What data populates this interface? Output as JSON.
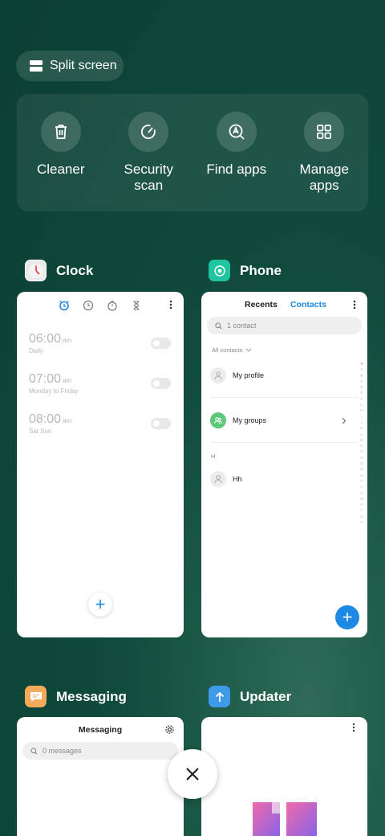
{
  "split_screen": {
    "label": "Split screen",
    "icon": "split-screen-icon"
  },
  "tools": [
    {
      "label": "Cleaner",
      "icon": "trash-icon"
    },
    {
      "label": "Security\nscan",
      "icon": "security-scan-icon"
    },
    {
      "label": "Find apps",
      "icon": "find-apps-icon"
    },
    {
      "label": "Manage\napps",
      "icon": "grid-icon"
    }
  ],
  "apps": {
    "clock": {
      "name": "Clock",
      "alarms": [
        {
          "time": "06:00",
          "ampm": "am",
          "repeat": "Daily"
        },
        {
          "time": "07:00",
          "ampm": "am",
          "repeat": "Monday to Friday"
        },
        {
          "time": "08:00",
          "ampm": "am",
          "repeat": "Sat Sun"
        }
      ],
      "add": "+"
    },
    "phone": {
      "name": "Phone",
      "tab_recents": "Recents",
      "tab_contacts": "Contacts",
      "search_placeholder": "1 contact",
      "filter": "All contacts",
      "my_profile": "My profile",
      "my_groups": "My groups",
      "section_h": "H",
      "contact_hh": "Hh",
      "alphabet": [
        "♥",
        "A",
        "B",
        "C",
        "D",
        "E",
        "F",
        "G",
        "H",
        "I",
        "J",
        "K",
        "L",
        "M",
        "N",
        "O",
        "P",
        "Q",
        "R",
        "S",
        "T",
        "U",
        "V",
        "W",
        "X",
        "Y",
        "Z",
        "#"
      ],
      "add": "+"
    },
    "messaging": {
      "name": "Messaging",
      "title": "Messaging",
      "search_placeholder": "0 messages"
    },
    "updater": {
      "name": "Updater"
    }
  },
  "colors": {
    "accent": "#1e88e5",
    "phone_icon": "#1fc4a0",
    "messaging_icon": "#f5a95b",
    "updater_icon": "#3d9be9"
  }
}
